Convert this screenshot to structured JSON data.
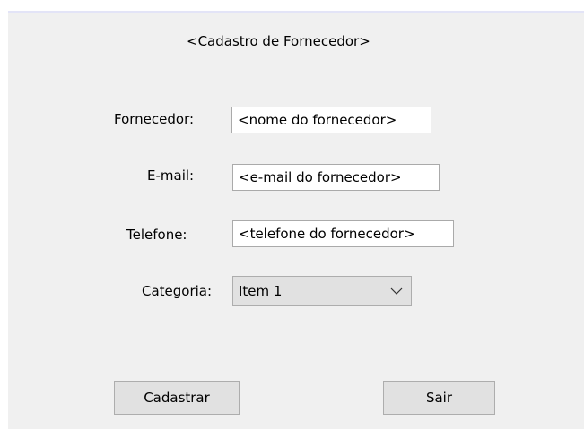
{
  "form": {
    "title": "<Cadastro de Fornecedor>",
    "fields": {
      "fornecedor": {
        "label": "Fornecedor:",
        "value": "<nome do fornecedor>"
      },
      "email": {
        "label": "E-mail:",
        "value": "<e-mail do fornecedor>"
      },
      "telefone": {
        "label": "Telefone:",
        "value": "<telefone do fornecedor>"
      },
      "categoria": {
        "label": "Categoria:",
        "selected": "Item 1",
        "icon": "chevron-down-icon"
      }
    },
    "buttons": {
      "cadastrar": "Cadastrar",
      "sair": "Sair"
    }
  },
  "colors": {
    "panel_background": "#f0f0f0",
    "panel_top_border": "#e3e4f7",
    "button_background": "#e1e1e1",
    "button_border": "#adadad",
    "field_border": "#aaaaaa"
  }
}
